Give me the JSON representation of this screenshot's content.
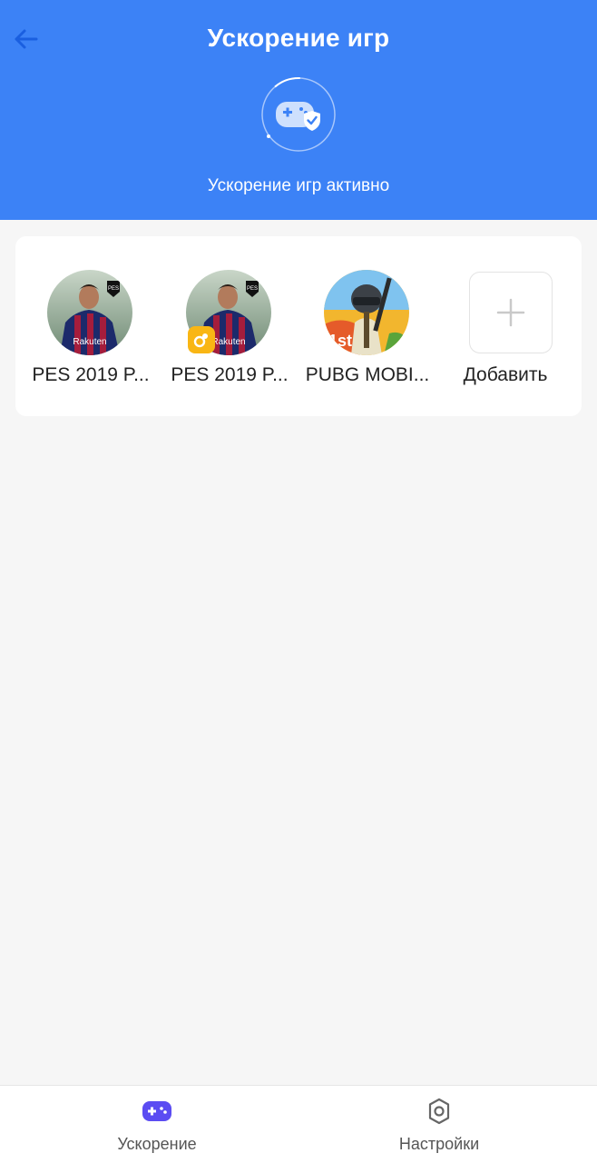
{
  "header": {
    "title": "Ускорение игр",
    "status_text": "Ускорение игр активно",
    "accent_color": "#3c82f6",
    "back_icon": "arrow-left-icon",
    "status_icon": "gamepad-shield-icon"
  },
  "games": {
    "items": [
      {
        "label": "PES 2019 P...",
        "icon": "pes-2019-icon",
        "badge": false
      },
      {
        "label": "PES 2019 P...",
        "icon": "pes-2019-icon",
        "badge": true,
        "badge_icon": "dual-app-badge-icon"
      },
      {
        "label": "PUBG MOBI...",
        "icon": "pubg-mobile-icon",
        "badge": false
      }
    ],
    "add_label": "Добавить",
    "add_icon": "plus-icon"
  },
  "bottom_nav": {
    "items": [
      {
        "label": "Ускорение",
        "icon": "gamepad-icon",
        "active": true,
        "color": "#5b4cf2"
      },
      {
        "label": "Настройки",
        "icon": "gear-icon",
        "active": false,
        "color": "#666666"
      }
    ]
  }
}
